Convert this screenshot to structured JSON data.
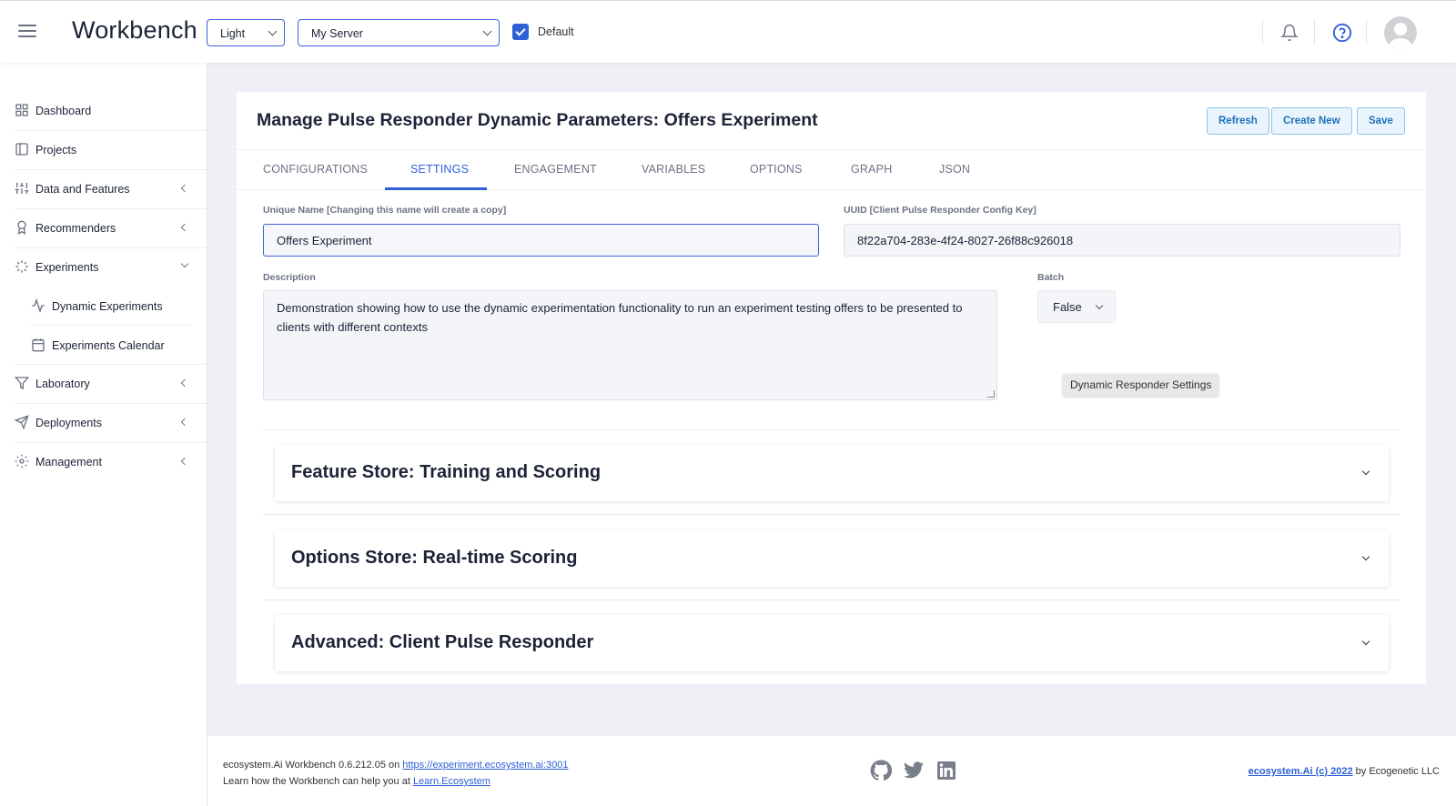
{
  "header": {
    "brand": "Workbench",
    "theme_select": "Light",
    "server_select": "My Server",
    "default_checked": true,
    "default_label": "Default"
  },
  "sidebar": {
    "items": [
      {
        "label": "Dashboard",
        "icon": "grid-icon"
      },
      {
        "label": "Projects",
        "icon": "book-icon"
      },
      {
        "label": "Data and Features",
        "icon": "sliders-icon",
        "expandable": true
      },
      {
        "label": "Recommenders",
        "icon": "award-icon",
        "expandable": true
      },
      {
        "label": "Experiments",
        "icon": "loader-icon",
        "expanded": true
      },
      {
        "label": "Dynamic Experiments",
        "icon": "activity-icon",
        "sub": true
      },
      {
        "label": "Experiments Calendar",
        "icon": "calendar-icon",
        "sub": true
      },
      {
        "label": "Laboratory",
        "icon": "filter-icon",
        "expandable": true
      },
      {
        "label": "Deployments",
        "icon": "send-icon",
        "expandable": true
      },
      {
        "label": "Management",
        "icon": "gear-icon",
        "expandable": true
      }
    ]
  },
  "main": {
    "title": "Manage Pulse Responder Dynamic Parameters: Offers Experiment",
    "buttons": {
      "refresh": "Refresh",
      "create": "Create New",
      "save": "Save"
    },
    "tabs": [
      "CONFIGURATIONS",
      "SETTINGS",
      "ENGAGEMENT",
      "VARIABLES",
      "OPTIONS",
      "GRAPH",
      "JSON"
    ],
    "active_tab": "SETTINGS",
    "fields": {
      "unique_name_label": "Unique Name [Changing this name will create a copy]",
      "unique_name_value": "Offers Experiment",
      "uuid_label": "UUID [Client Pulse Responder Config Key]",
      "uuid_value": "8f22a704-283e-4f24-8027-26f88c926018",
      "description_label": "Description",
      "description_value": "Demonstration showing how to use the dynamic experimentation functionality to run an experiment testing offers to be presented to clients with different contexts",
      "batch_label": "Batch",
      "batch_value": "False"
    },
    "tooltip": "Dynamic Responder Settings",
    "panels": [
      "Feature Store: Training and Scoring",
      "Options Store: Real-time Scoring",
      "Advanced: Client Pulse Responder"
    ]
  },
  "footer": {
    "version_text": "ecosystem.Ai Workbench 0.6.212.05 on ",
    "version_link": "https://experiment.ecosystem.ai:3001",
    "learn_text": "Learn how the Workbench can help you at ",
    "learn_link": "Learn.Ecosystem",
    "copyright_link": "ecosystem.Ai (c) 2022",
    "copyright_text": " by Ecogenetic LLC"
  }
}
